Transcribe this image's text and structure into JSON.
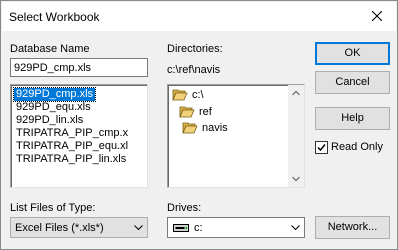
{
  "window": {
    "title": "Select Workbook"
  },
  "database_name": {
    "label": "Database Name",
    "value": "929PD_cmp.xls",
    "files": [
      "929PD_cmp.xls",
      "929PD_equ.xls",
      "929PD_lin.xls",
      "TRIPATRA_PIP_cmp.x",
      "TRIPATRA_PIP_equ.xl",
      "TRIPATRA_PIP_lin.xls"
    ],
    "selected_index": 0
  },
  "directories": {
    "label": "Directories:",
    "current_path": "c:\\ref\\navis",
    "tree": [
      "c:\\",
      "ref",
      "navis"
    ]
  },
  "buttons": {
    "ok": "OK",
    "cancel": "Cancel",
    "help": "Help",
    "network": "Network..."
  },
  "read_only": {
    "label": "Read Only",
    "checked": true
  },
  "file_type": {
    "label": "List Files of Type:",
    "value": "Excel Files (*.xls*)"
  },
  "drives": {
    "label": "Drives:",
    "value": "c:"
  },
  "icons": {
    "close": "close-icon",
    "folder_open": "folder-open-icon",
    "drive": "hard-drive-icon",
    "chevron": "chevron-down-icon"
  }
}
